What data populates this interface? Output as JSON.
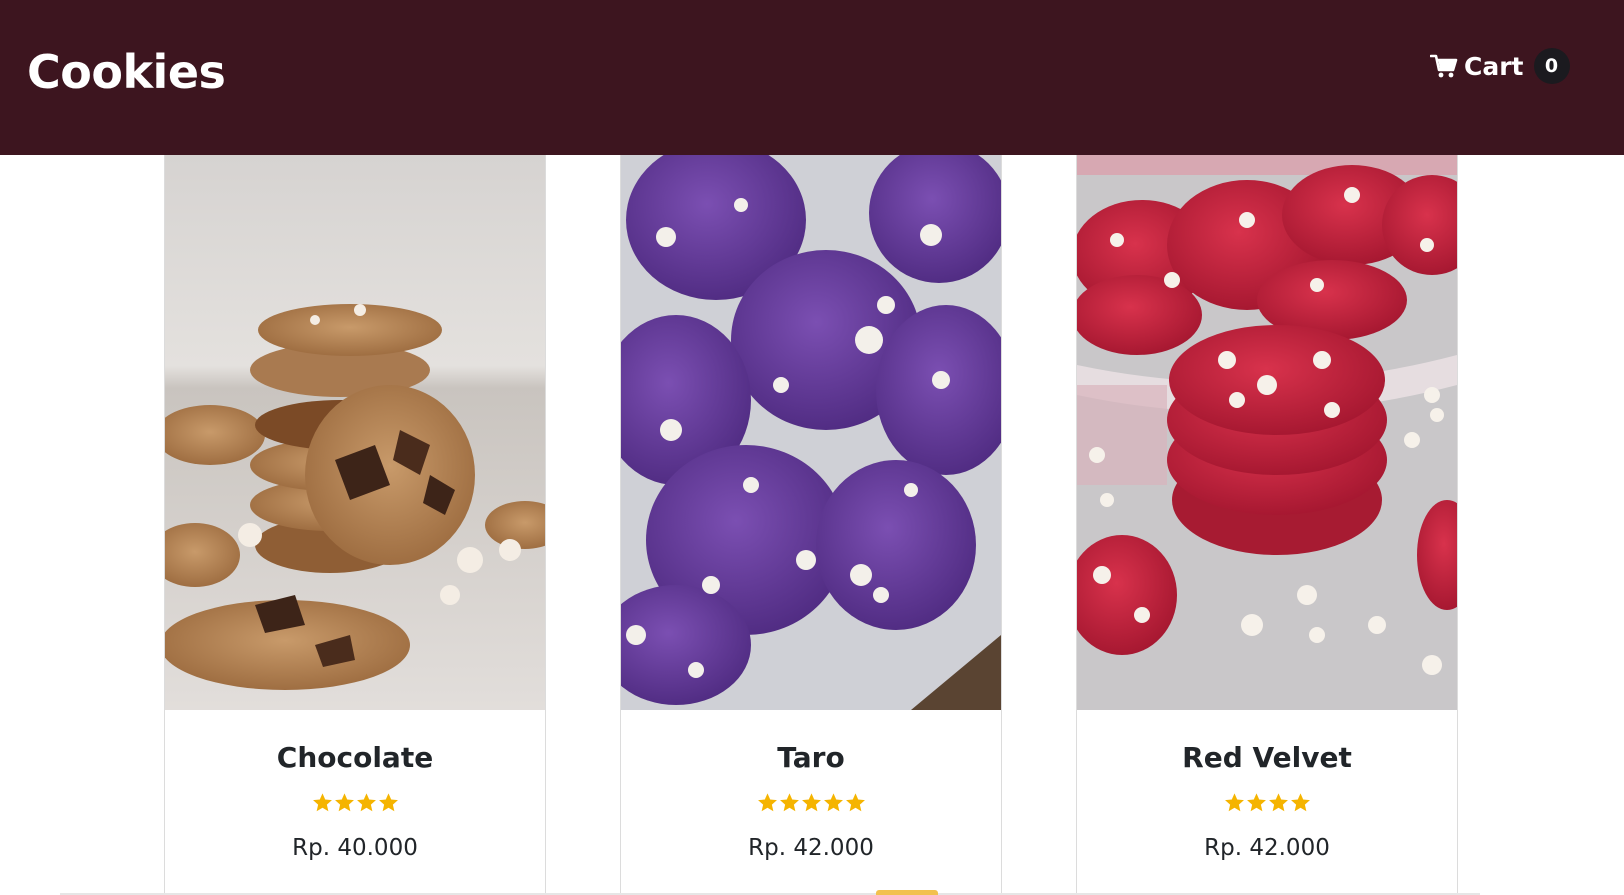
{
  "header": {
    "brand": "Cookies",
    "cart_label": "Cart",
    "cart_count": "0",
    "cart_icon": "shopping-cart-icon"
  },
  "colors": {
    "navbar": "#3d151f",
    "badge": "#1b1a1f",
    "star": "#f5b400",
    "text": "#212529"
  },
  "products": [
    {
      "name": "Chocolate",
      "rating": 4,
      "price": "Rp. 40.000",
      "image": "chocolate-cookies-photo"
    },
    {
      "name": "Taro",
      "rating": 5,
      "price": "Rp. 42.000",
      "image": "taro-cookies-photo"
    },
    {
      "name": "Red Velvet",
      "rating": 4,
      "price": "Rp. 42.000",
      "image": "red-velvet-cookies-photo"
    }
  ]
}
